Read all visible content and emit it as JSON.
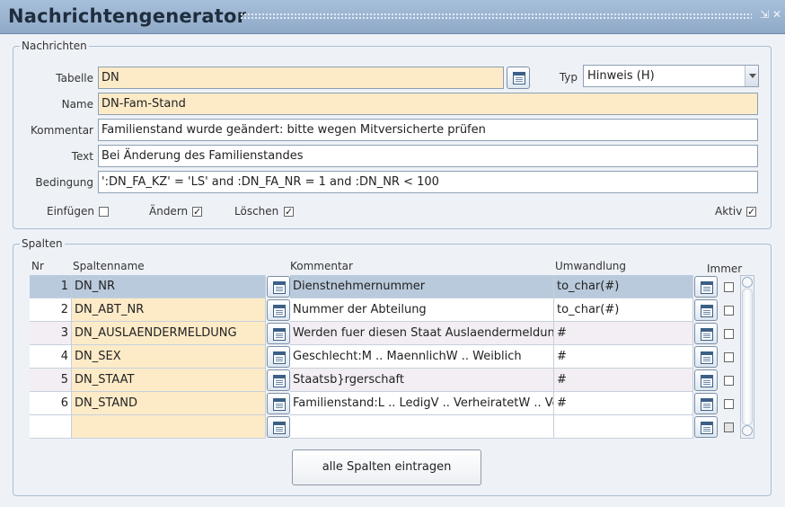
{
  "window": {
    "title": "Nachrichtengenerator"
  },
  "nachrichten": {
    "legend": "Nachrichten",
    "tabelle": {
      "label": "Tabelle",
      "value": "DN"
    },
    "typ": {
      "label": "Typ",
      "value": "Hinweis (H)"
    },
    "name": {
      "label": "Name",
      "value": "DN-Fam-Stand"
    },
    "kommentar": {
      "label": "Kommentar",
      "value": "Familienstand wurde geändert: bitte wegen Mitversicherte prüfen"
    },
    "text": {
      "label": "Text",
      "value": "Bei Änderung des Familienstandes"
    },
    "bedingung": {
      "label": "Bedingung",
      "value": "':DN_FA_KZ' = 'LS' and :DN_FA_NR = 1 and :DN_NR < 100"
    },
    "flags": {
      "einfuegen": {
        "label": "Einfügen",
        "checked": false
      },
      "aendern": {
        "label": "Ändern",
        "checked": true
      },
      "loeschen": {
        "label": "Löschen",
        "checked": true
      },
      "aktiv": {
        "label": "Aktiv",
        "checked": true
      }
    }
  },
  "spalten": {
    "legend": "Spalten",
    "headers": {
      "nr": "Nr",
      "spaltenname": "Spaltenname",
      "kommentar": "Kommentar",
      "umwandlung": "Umwandlung",
      "immer": "Immer"
    },
    "rows": [
      {
        "nr": "1",
        "spaltenname": "DN_NR",
        "kommentar": "Dienstnehmernummer",
        "umwandlung": "to_char(#)",
        "immer": false
      },
      {
        "nr": "2",
        "spaltenname": "DN_ABT_NR",
        "kommentar": "Nummer der Abteilung",
        "umwandlung": "to_char(#)",
        "immer": false
      },
      {
        "nr": "3",
        "spaltenname": "DN_AUSLAENDERMELDUNG",
        "kommentar": "Werden fuer diesen Staat Auslaendermeldung",
        "umwandlung": "#",
        "immer": false
      },
      {
        "nr": "4",
        "spaltenname": "DN_SEX",
        "kommentar": "Geschlecht:M .. MaennlichW .. Weiblich",
        "umwandlung": "#",
        "immer": false
      },
      {
        "nr": "5",
        "spaltenname": "DN_STAAT",
        "kommentar": "Staatsb}rgerschaft",
        "umwandlung": "#",
        "immer": false
      },
      {
        "nr": "6",
        "spaltenname": "DN_STAND",
        "kommentar": "Familienstand:L .. LedigV .. VerheiratetW .. Ve",
        "umwandlung": "#",
        "immer": false
      },
      {
        "nr": "",
        "spaltenname": "",
        "kommentar": "",
        "umwandlung": "",
        "immer": false
      }
    ],
    "button_label": "alle Spalten eintragen"
  },
  "colors": {
    "required_field": "#fdebc8",
    "selected_row": "#b9cadc",
    "titlebar": "#9bb4d2"
  }
}
